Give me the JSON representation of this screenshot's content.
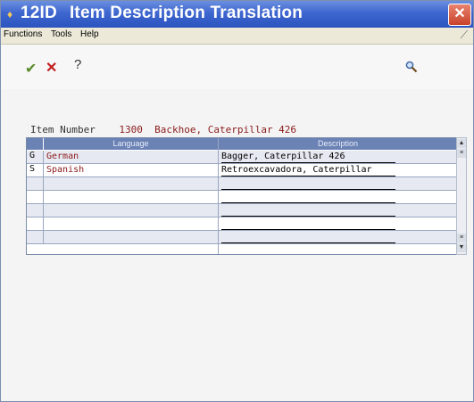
{
  "window": {
    "code": "12ID",
    "title": "Item Description Translation",
    "close_glyph": "✕"
  },
  "menu": {
    "items": [
      "Functions",
      "Tools",
      "Help"
    ]
  },
  "toolbar": {
    "ok_icon": "checkmark-icon",
    "cancel_icon": "x-icon",
    "help_label": "?",
    "search_icon": "magnifier-icon"
  },
  "item": {
    "label": "Item Number",
    "number": "1300",
    "description": "Backhoe, Caterpillar 426"
  },
  "grid": {
    "headers": [
      "Language",
      "Description"
    ],
    "rows": [
      {
        "code": "G",
        "language": "German",
        "description": "Bagger, Caterpillar 426"
      },
      {
        "code": "S",
        "language": "Spanish",
        "description": "Retroexcavadora, Caterpillar"
      },
      {
        "code": "",
        "language": "",
        "description": ""
      },
      {
        "code": "",
        "language": "",
        "description": ""
      },
      {
        "code": "",
        "language": "",
        "description": ""
      },
      {
        "code": "",
        "language": "",
        "description": ""
      },
      {
        "code": "",
        "language": "",
        "description": ""
      },
      {
        "code": "",
        "language": "",
        "description": ""
      }
    ]
  },
  "colors": {
    "title_bar": "#3e66cf",
    "grid_header": "#6b82b4",
    "value_text": "#8b1a1a"
  }
}
